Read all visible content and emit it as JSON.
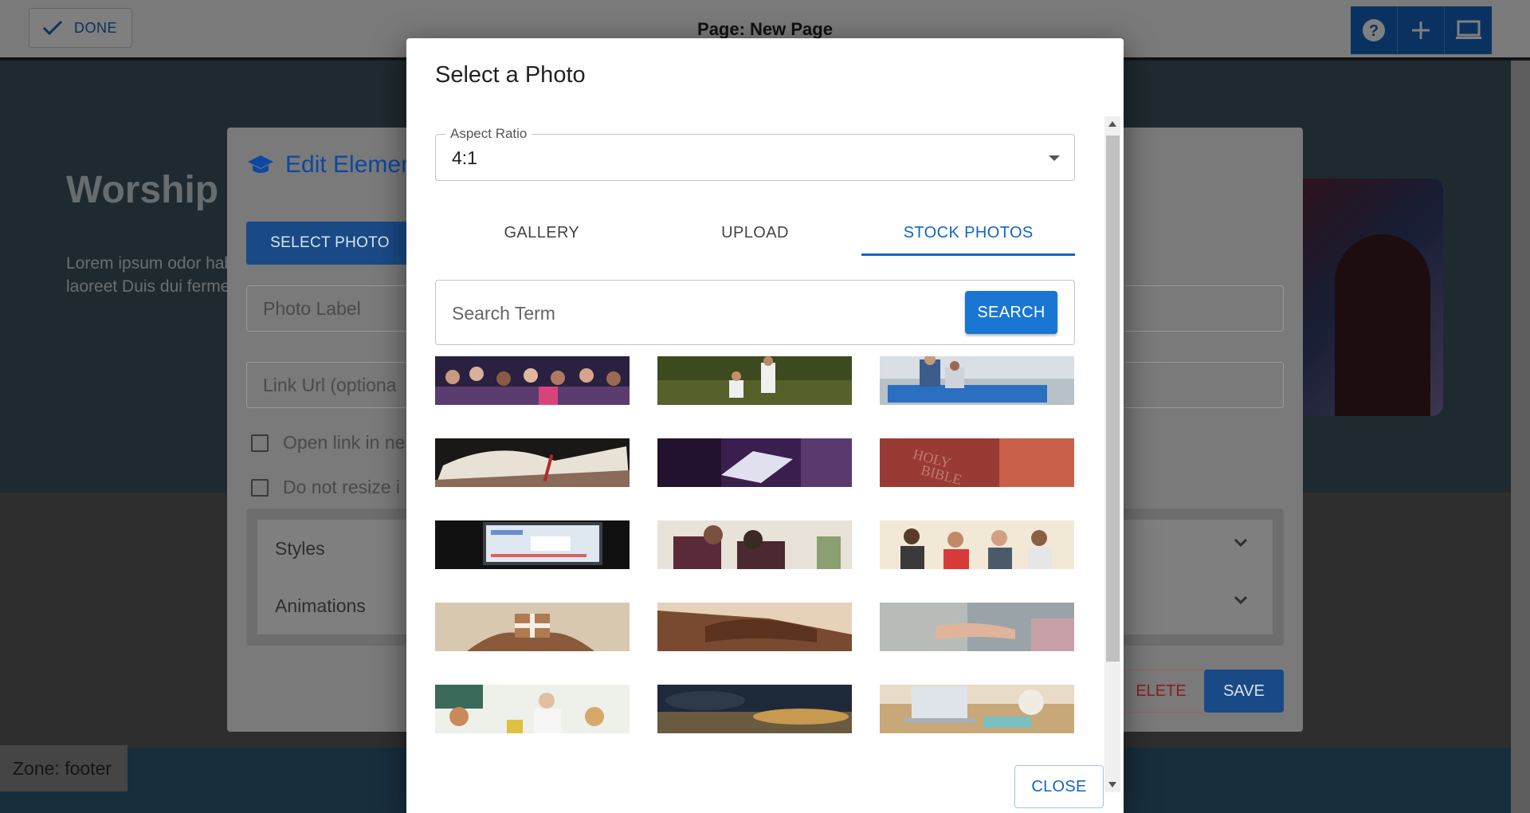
{
  "topbar": {
    "done_label": "DONE",
    "page_title": "Page: New Page",
    "tools": [
      "help-icon",
      "add-icon",
      "desktop-icon"
    ]
  },
  "hero": {
    "heading": "Worship",
    "text": "Lorem ipsum odor habitasse mollis hi Malesuada laoreet Duis dui fermentun"
  },
  "edit_dialog": {
    "title": "Edit Elemen",
    "select_photo_label": "SELECT PHOTO",
    "photo_label_placeholder": "Photo Label",
    "link_url_placeholder": "Link Url (optiona",
    "open_link_label": "Open link in ne",
    "no_resize_label": "Do not resize i",
    "accordion": [
      "Styles",
      "Animations"
    ],
    "delete_label": "ELETE",
    "save_label": "SAVE"
  },
  "zone_label": "Zone: footer",
  "photo_dialog": {
    "title": "Select a Photo",
    "aspect_label": "Aspect Ratio",
    "aspect_value": "4:1",
    "tabs": [
      {
        "label": "GALLERY",
        "active": false
      },
      {
        "label": "UPLOAD",
        "active": false
      },
      {
        "label": "STOCK PHOTOS",
        "active": true
      }
    ],
    "search_placeholder": "Search Term",
    "search_label": "SEARCH",
    "close_label": "CLOSE",
    "photos": [
      "worship-crowd",
      "baptism-lake",
      "baptism-pool",
      "open-bible",
      "bible-reading-purple",
      "holy-bible-cover",
      "computer-screen",
      "prayer-couple",
      "group-of-friends",
      "gift-hands",
      "holding-hands",
      "comfort-hands",
      "children-class",
      "sky-clouds",
      "laptop-desk"
    ]
  },
  "colors": {
    "primary": "#1565c0",
    "primary_button": "#1976d2",
    "danger": "#c62828"
  }
}
